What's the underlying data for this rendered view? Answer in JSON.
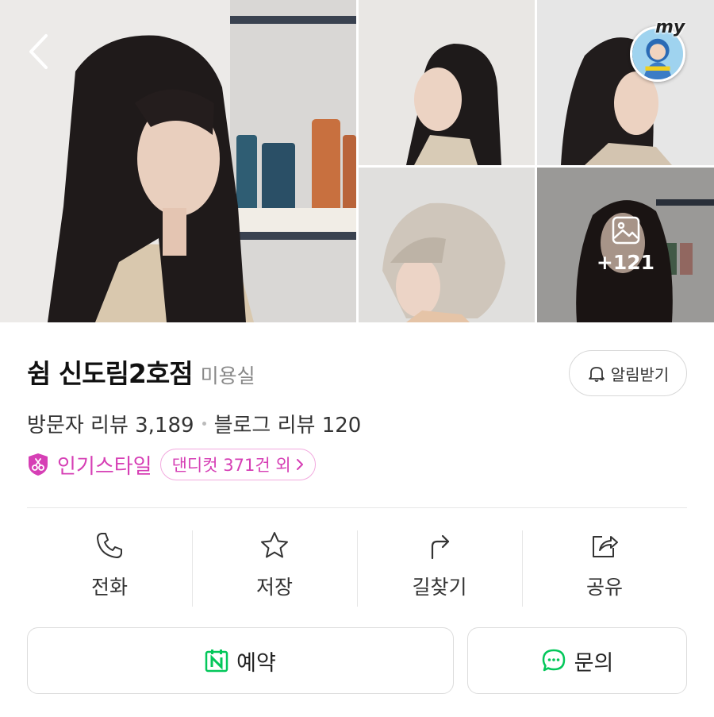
{
  "gallery": {
    "more_count": "+121",
    "my_label": "my"
  },
  "shop": {
    "name": "쉼 신도림2호점",
    "category": "미용실",
    "notify_label": "알림받기"
  },
  "reviews": {
    "visitor": "방문자 리뷰 3,189",
    "blog": "블로그 리뷰 120"
  },
  "popular_style": {
    "label": "인기스타일",
    "chip": "댄디컷 371건 외"
  },
  "actions": [
    {
      "label": "전화",
      "icon": "phone-icon"
    },
    {
      "label": "저장",
      "icon": "star-icon"
    },
    {
      "label": "길찾기",
      "icon": "directions-icon"
    },
    {
      "label": "공유",
      "icon": "share-icon"
    }
  ],
  "buttons": {
    "reserve_label": "예약",
    "inquiry_label": "문의"
  },
  "colors": {
    "accent_pink": "#d63fb5",
    "naver_green": "#03c75a"
  }
}
